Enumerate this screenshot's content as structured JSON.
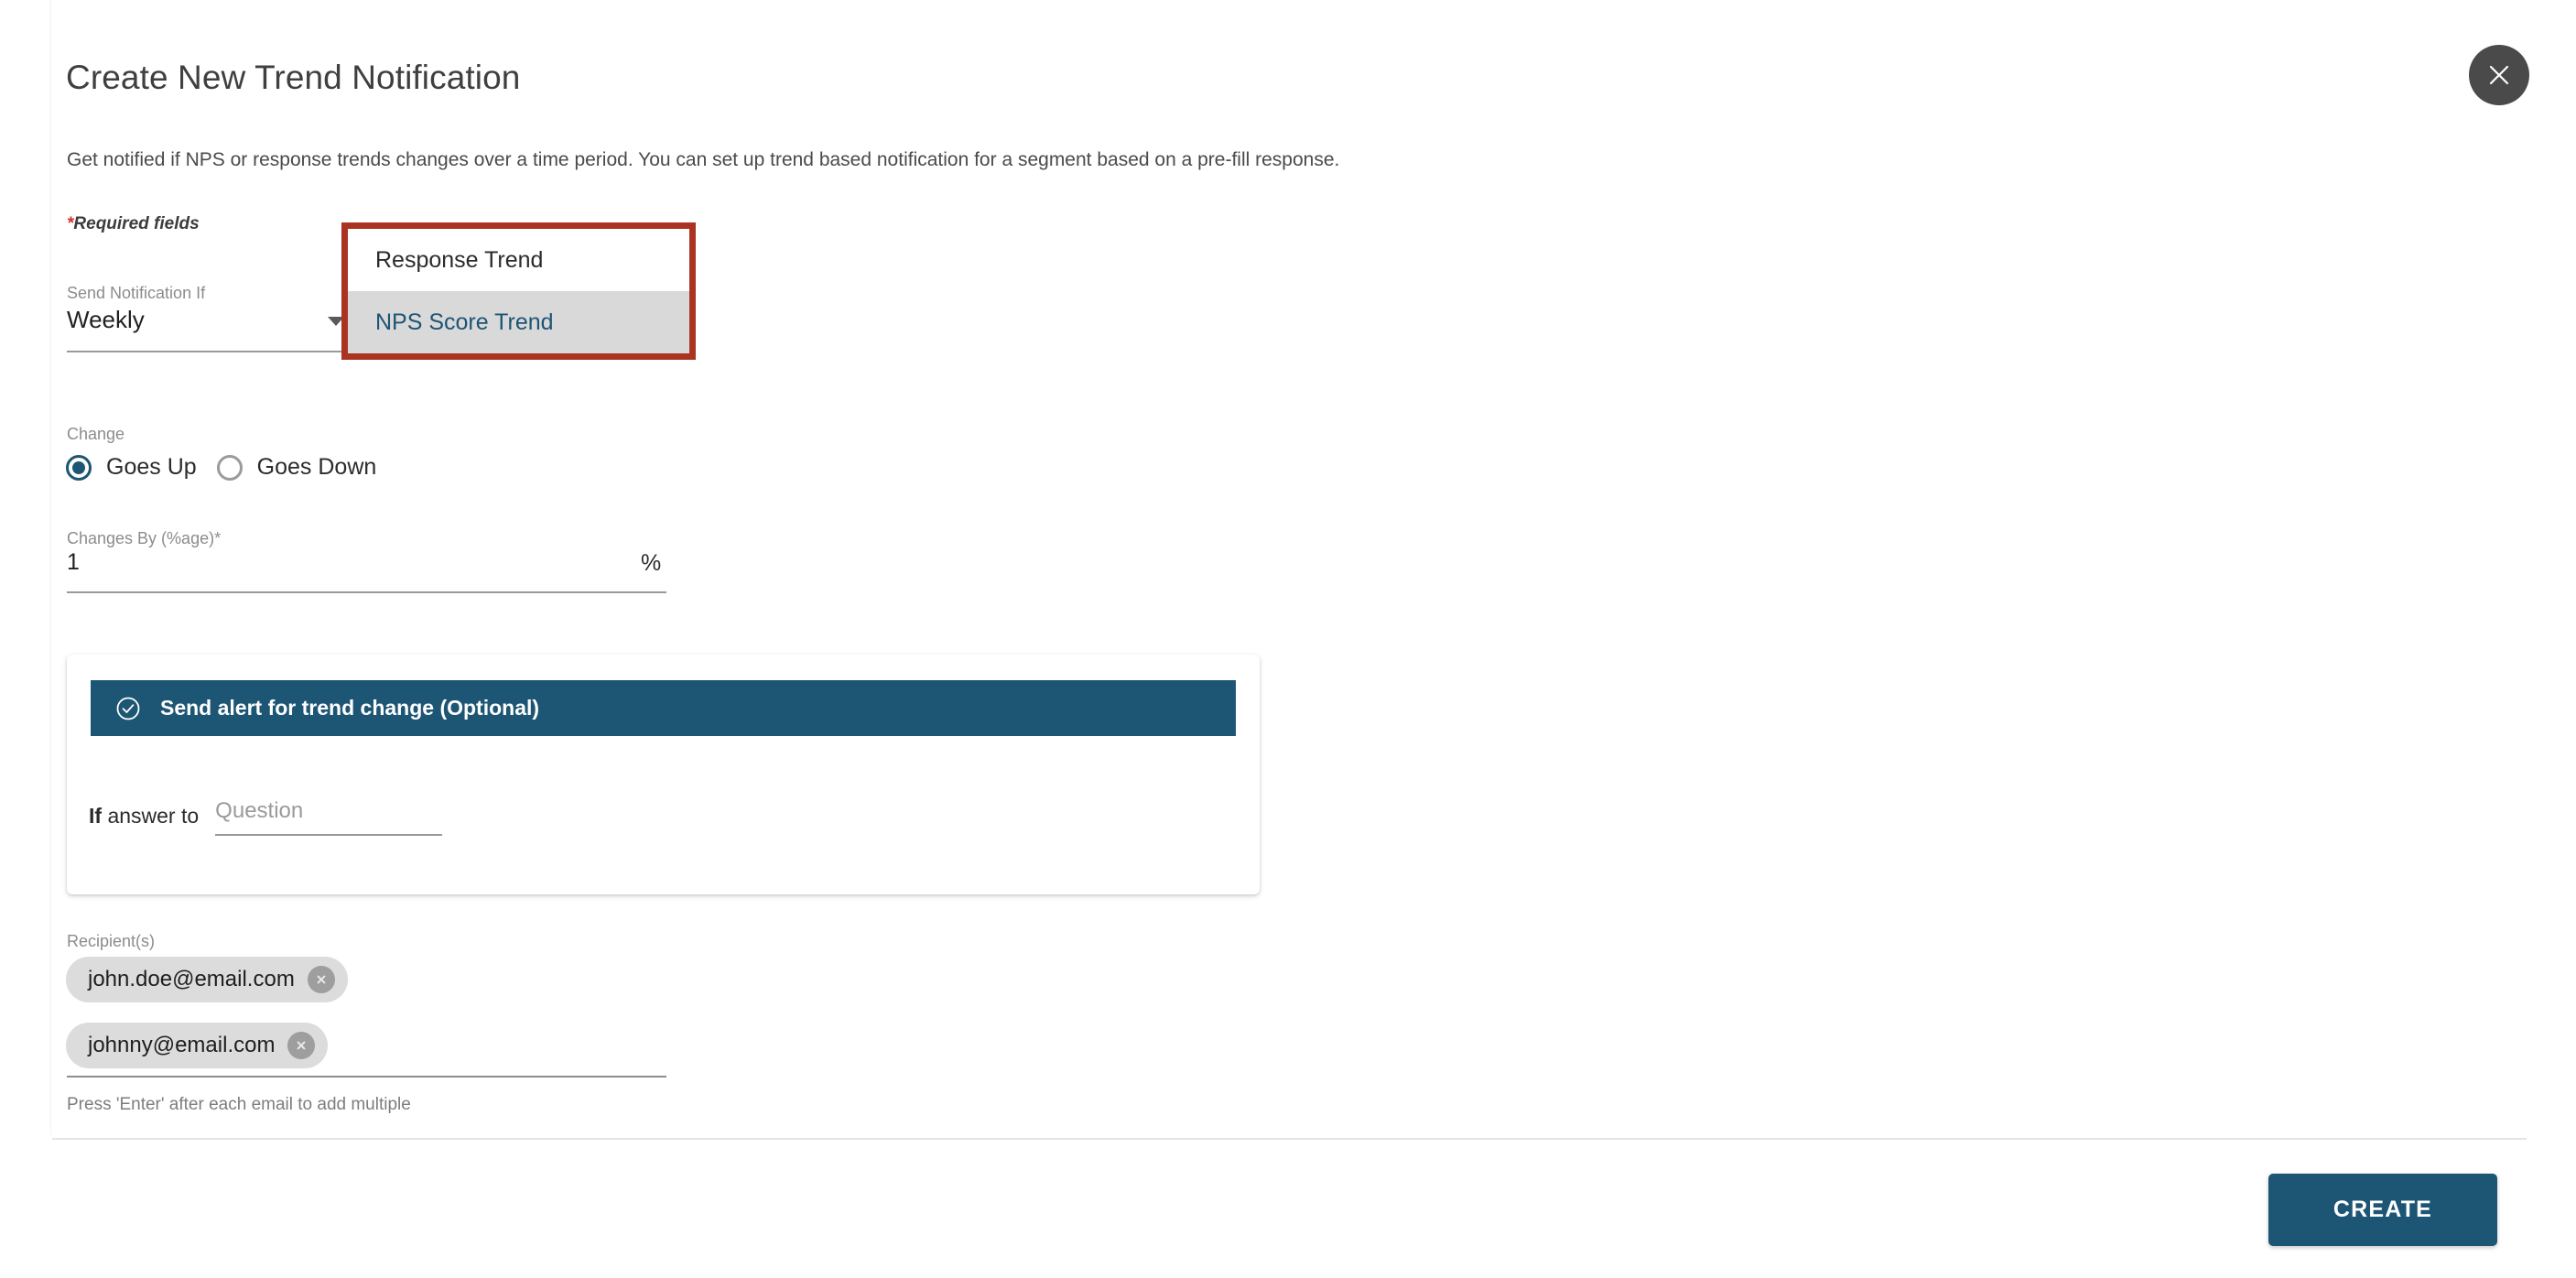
{
  "modal": {
    "title": "Create New Trend Notification",
    "description": "Get notified if NPS or response trends changes over a time period. You can set up trend based notification for a segment based on a pre-fill response.",
    "required_note_star": "*",
    "required_note_text": "Required fields",
    "close_icon": "close-icon"
  },
  "send_notification_if": {
    "label": "Send Notification If",
    "value": "Weekly",
    "caret_icon": "chevron-down-icon"
  },
  "trend_type_dropdown": {
    "highlight_color": "#ab3322",
    "options": [
      {
        "label": "Response Trend",
        "selected": false
      },
      {
        "label": "NPS Score Trend",
        "selected": true
      }
    ]
  },
  "change": {
    "label": "Change",
    "options": [
      {
        "label": "Goes Up",
        "checked": true
      },
      {
        "label": "Goes Down",
        "checked": false
      }
    ]
  },
  "changes_by": {
    "label": "Changes By (%age)*",
    "value": "1",
    "suffix": "%"
  },
  "alert_panel": {
    "header_label": "Send alert for trend change (Optional)",
    "header_icon": "check-circle-icon",
    "header_color": "#1d5574",
    "if_prefix_bold": "If",
    "if_prefix_rest": " answer to",
    "question_placeholder": "Question"
  },
  "recipients": {
    "label": "Recipient(s)",
    "chips": [
      {
        "email": "john.doe@email.com",
        "remove_icon": "remove-chip-icon"
      },
      {
        "email": "johnny@email.com",
        "remove_icon": "remove-chip-icon"
      }
    ],
    "hint": "Press 'Enter' after each email to add multiple"
  },
  "footer": {
    "create_label": "CREATE",
    "accent_color": "#1d5574"
  }
}
